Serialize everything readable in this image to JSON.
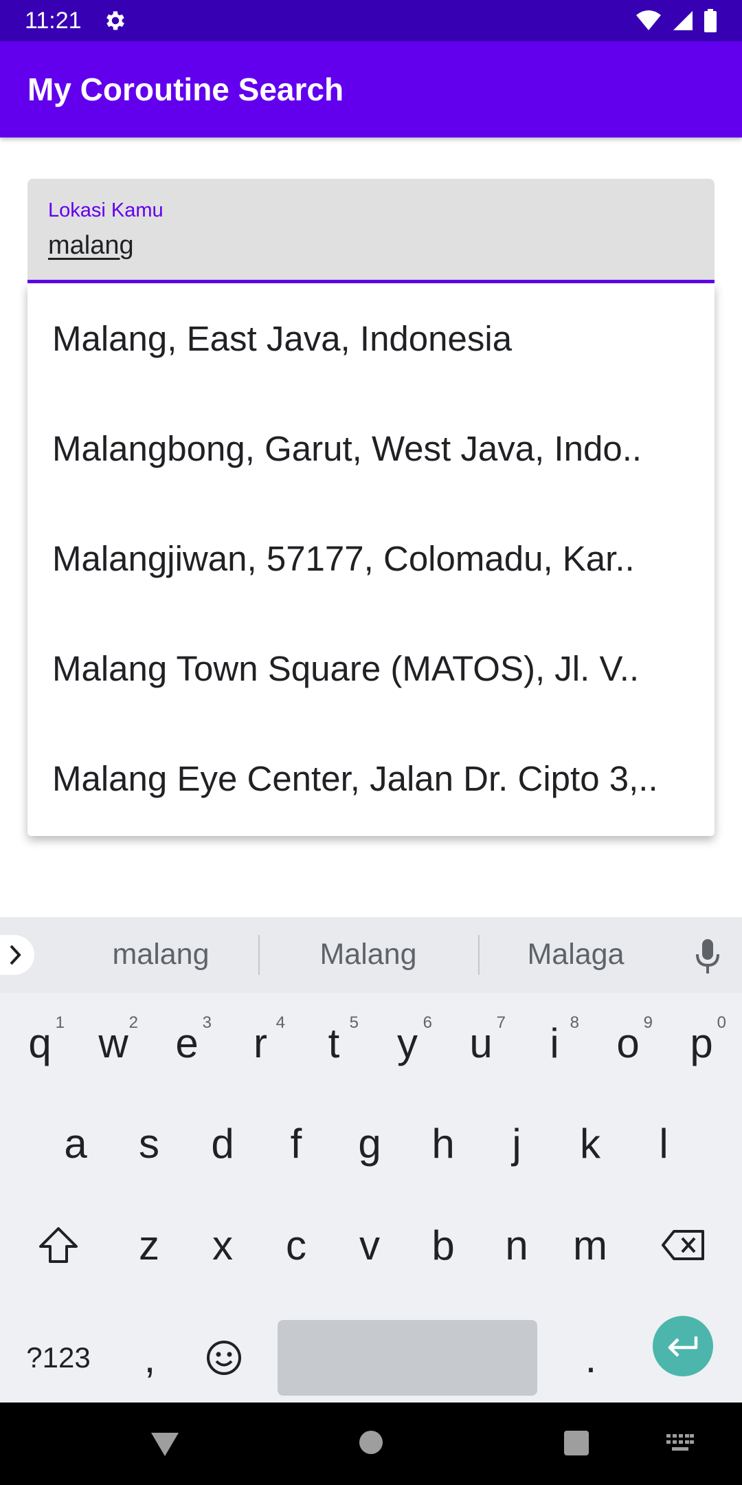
{
  "status_bar": {
    "time": "11:21",
    "icons": [
      "settings-gear-icon",
      "wifi-icon",
      "signal-icon",
      "battery-icon"
    ]
  },
  "app_bar": {
    "title": "My Coroutine Search"
  },
  "search_field": {
    "label": "Lokasi Kamu",
    "value": "malang"
  },
  "suggestions": [
    "Malang, East Java, Indonesia",
    "Malangbong, Garut, West Java, Indo..",
    "Malangjiwan, 57177, Colomadu, Kar..",
    "Malang Town Square (MATOS), Jl. V..",
    "Malang Eye Center, Jalan Dr. Cipto 3,.."
  ],
  "keyboard": {
    "suggestions": [
      "malang",
      "Malang",
      "Malaga"
    ],
    "row1": [
      {
        "key": "q",
        "num": "1"
      },
      {
        "key": "w",
        "num": "2"
      },
      {
        "key": "e",
        "num": "3"
      },
      {
        "key": "r",
        "num": "4"
      },
      {
        "key": "t",
        "num": "5"
      },
      {
        "key": "y",
        "num": "6"
      },
      {
        "key": "u",
        "num": "7"
      },
      {
        "key": "i",
        "num": "8"
      },
      {
        "key": "o",
        "num": "9"
      },
      {
        "key": "p",
        "num": "0"
      }
    ],
    "row2": [
      "a",
      "s",
      "d",
      "f",
      "g",
      "h",
      "j",
      "k",
      "l"
    ],
    "row3": [
      "z",
      "x",
      "c",
      "v",
      "b",
      "n",
      "m"
    ],
    "symbols_label": "?123",
    "comma": ",",
    "period": "."
  },
  "colors": {
    "status_bar": "#3700b3",
    "primary": "#6200ee",
    "enter_key": "#4db6ac"
  }
}
